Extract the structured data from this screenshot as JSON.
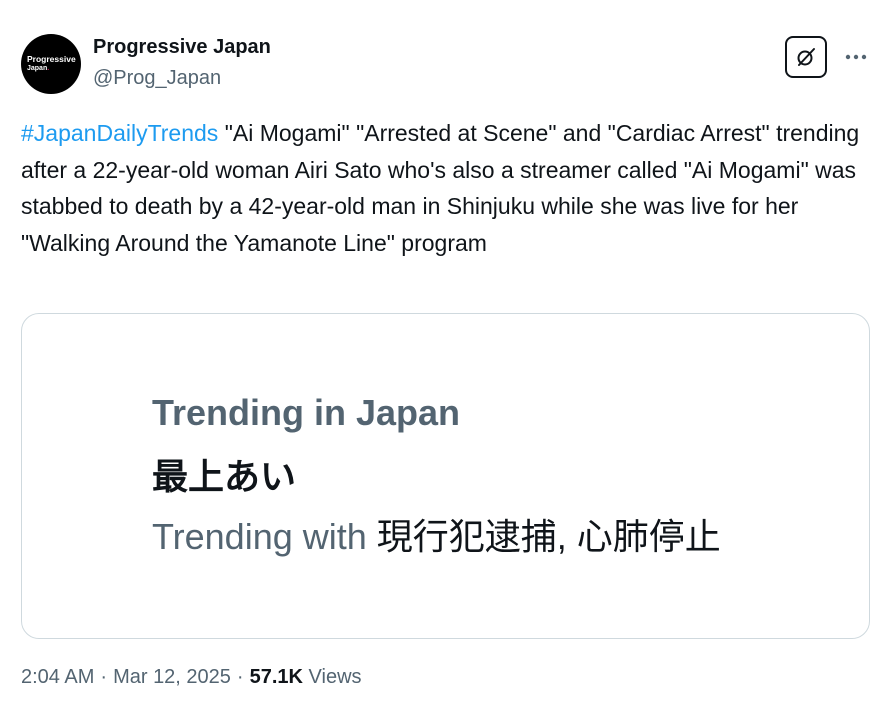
{
  "author": {
    "avatar_line1": "Progressive",
    "avatar_line2": "Japan",
    "avatar_line2_dot": ".",
    "display_name": "Progressive Japan",
    "handle": "@Prog_Japan"
  },
  "header_actions": {
    "grok_icon": "grok-icon",
    "more_icon": "more-icon"
  },
  "tweet": {
    "hashtag": "#JapanDailyTrends",
    "body": " \"Ai Mogami\" \"Arrested at Scene\" and \"Cardiac Arrest\" trending after a 22-year-old woman Airi Sato who's also a streamer called \"Ai Mogami\" was stabbed to death by a 42-year-old man in Shinjuku while she was live for her \"Walking Around the Yamanote Line\" program"
  },
  "card": {
    "trending_label": "Trending in Japan",
    "topic": "最上あい",
    "with_label": "Trending with ",
    "with_terms": "現行犯逮捕, 心肺停止"
  },
  "meta": {
    "time": "2:04 AM",
    "sep1": "·",
    "date": "Mar 12, 2025",
    "sep2": "·",
    "views_count": "57.1K",
    "views_label": " Views"
  },
  "colors": {
    "hashtag": "#1d9bf0",
    "primary_text": "#0f1419",
    "secondary_text": "#536471",
    "border": "#cfd9de"
  }
}
